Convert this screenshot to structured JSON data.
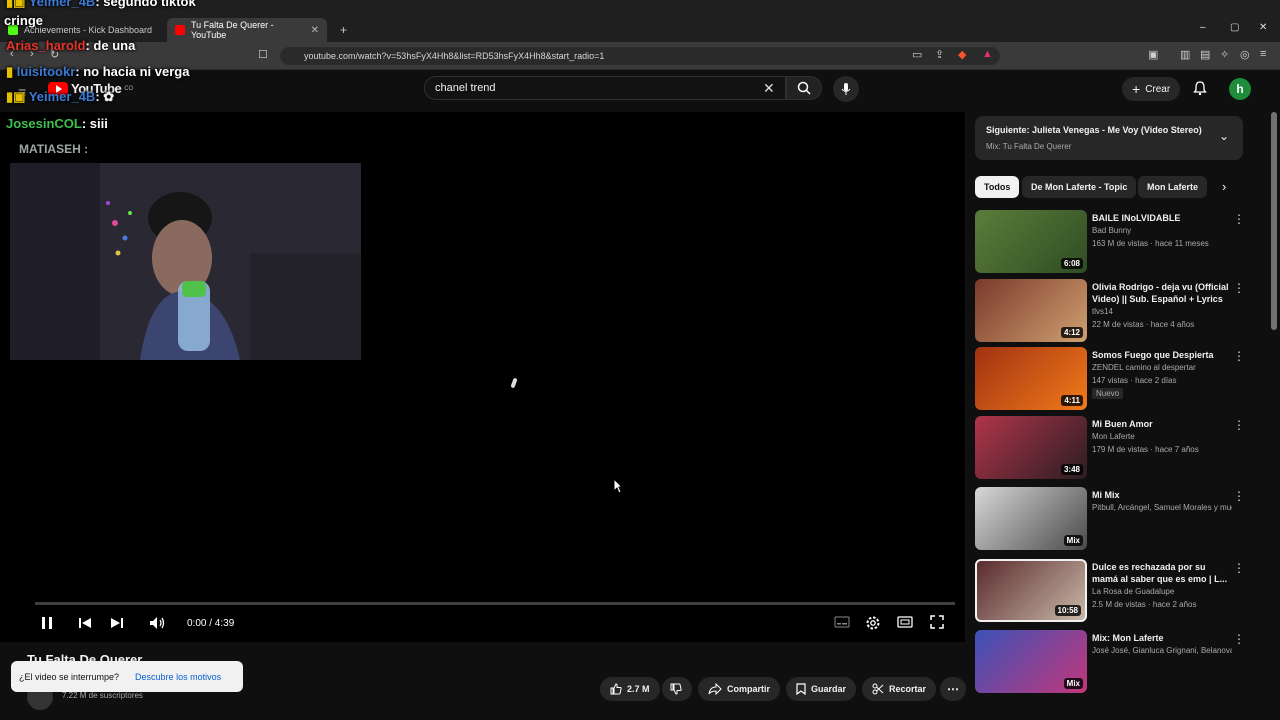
{
  "colors": {
    "yt_red": "#ff0000",
    "accent_link": "#065fd4",
    "bg": "#0f0f0f"
  },
  "browser": {
    "tabs": [
      {
        "label": "Achievements - Kick Dashboard",
        "active": false
      },
      {
        "label": "Tu Falta De Querer - YouTube",
        "active": true
      }
    ],
    "new_tab": "+",
    "url": "youtube.com/watch?v=53hsFyX4Hh8&list=RD53hsFyX4Hh8&start_radio=1",
    "win_minimize": "–",
    "win_restore": "▢",
    "win_close": "✕"
  },
  "header": {
    "logo_text": "YouTube",
    "logo_region": "CO",
    "search_value": "chanel trend",
    "create_label": "Crear",
    "avatar_letter": "h"
  },
  "chat": [
    {
      "name": "Yeimer_4B",
      "msg": ": segundo tiktok",
      "color": "#3a7bd5"
    },
    {
      "name": "",
      "msg": "cringe",
      "color": "#ffffff"
    },
    {
      "name": "Arias_harold",
      "msg": ": de una",
      "color": "#e5352a"
    },
    {
      "name": "luisitookr",
      "msg": ": no hacia ni verga",
      "color": "#3a7bd5"
    },
    {
      "name": "Yeimer_4B",
      "msg": ":",
      "color": "#3a7bd5"
    },
    {
      "name": "JosesinCOL",
      "msg": ": siii",
      "color": "#3fbf4f"
    },
    {
      "name": "MATIASEH :",
      "msg": "",
      "color": "#9aa7a0"
    }
  ],
  "player": {
    "time": "0:00 / 4:39"
  },
  "video": {
    "title": "Tu Falta De Querer",
    "subscribers": "7.22 M de suscriptores",
    "toast_text": "¿El video se interrumpe?",
    "toast_link": "Descubre los motivos",
    "likes": "2.7 M",
    "share": "Compartir",
    "save": "Guardar",
    "clip": "Recortar"
  },
  "sidebar": {
    "next_label": "Siguiente: Julieta Venegas - Me Voy (Video Stereo)",
    "next_sub": "Mix: Tu Falta De Querer",
    "chips": [
      "Todos",
      "De Mon Laferte - Topic",
      "Mon Laferte"
    ],
    "items": [
      {
        "title": "BAILE INoLVIDABLE",
        "channel": "Bad Bunny",
        "meta": "163 M de vistas · hace 11 meses",
        "duration": "6:08",
        "colors": [
          "#5b7d3a",
          "#2f4d24"
        ]
      },
      {
        "title": "Olivia Rodrigo - deja vu (Official Video) || Sub. Español + Lyrics",
        "channel": "tlvs14",
        "meta": "22 M de vistas · hace 4 años",
        "duration": "4:12",
        "colors": [
          "#7a3a2c",
          "#d0a070"
        ]
      },
      {
        "title": "Somos Fuego que Despierta",
        "channel": "ZENDEL camino al despertar",
        "meta": "147 vistas · hace 2 días",
        "duration": "4:11",
        "badge": "Nuevo",
        "colors": [
          "#a13212",
          "#f27a1a"
        ]
      },
      {
        "title": "Mi Buen Amor",
        "channel": "Mon Laferte",
        "meta": "179 M de vistas · hace 7 años",
        "duration": "3:48",
        "colors": [
          "#b0354a",
          "#2a1d22"
        ]
      },
      {
        "title": "Mi Mix",
        "channel": "Pitbull, Arcángel, Samuel Morales y muc...",
        "meta": "",
        "duration": "Mix",
        "colors": [
          "#d8d8d8",
          "#4a4a4a"
        ]
      },
      {
        "title": "Dulce es rechazada por su mamá al saber que es emo | L...",
        "channel": "La Rosa de Guadalupe",
        "meta": "2.5 M de vistas · hace 2 años",
        "duration": "10:58",
        "colors": [
          "#5a2b2e",
          "#c9b8a8"
        ]
      },
      {
        "title": "Mix: Mon Laferte",
        "channel": "José José, Gianluca Grignani, Belanova y...",
        "meta": "",
        "duration": "Mix",
        "colors": [
          "#3c52b8",
          "#c2377a"
        ]
      }
    ]
  }
}
